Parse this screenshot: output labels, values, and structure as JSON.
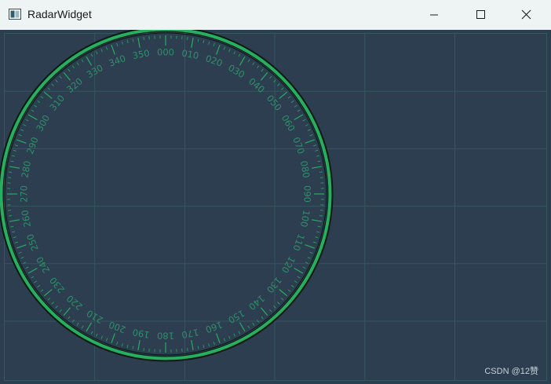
{
  "window": {
    "title": "RadarWidget",
    "icon": "app-window-icon",
    "controls": {
      "minimize": "minimize-icon",
      "maximize": "maximize-icon",
      "close": "close-icon"
    }
  },
  "radar": {
    "bearing_labels": [
      "000",
      "010",
      "020",
      "030",
      "040",
      "050",
      "060",
      "070",
      "080",
      "090",
      "100",
      "110",
      "120",
      "130",
      "140",
      "150",
      "160",
      "170",
      "180",
      "190",
      "200",
      "210",
      "220",
      "230",
      "240",
      "250",
      "260",
      "270",
      "280",
      "290",
      "300",
      "310",
      "320",
      "330",
      "340",
      "350"
    ],
    "colors": {
      "background": "#2c3e50",
      "grid": "#35575e",
      "ring": "#27ae60",
      "ring_outline": "#0c1a12",
      "ticks": "#27ae60",
      "labels": "#2f8f6a"
    }
  },
  "watermark": "CSDN @12赞"
}
